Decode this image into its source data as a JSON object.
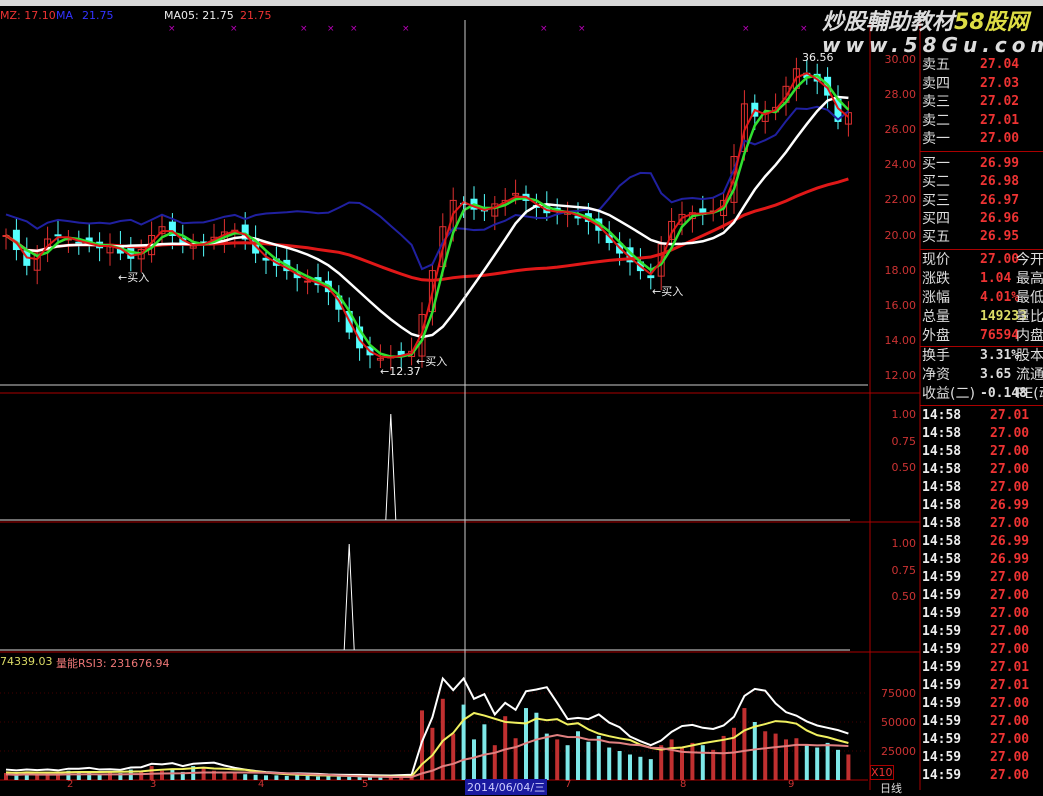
{
  "header": {
    "mz_label": "MZ: 17.10",
    "blue_label": "MA",
    "blue_value": "21.75",
    "ma05_label": "MA05: 21.75",
    "ma05_value": "21.75"
  },
  "watermark": {
    "line1": "炒股輔助教材",
    "line1_brand": "58股网",
    "line2": "www.58Gu.com"
  },
  "annotations": {
    "buy": "←买入",
    "low": "←12.37",
    "high": "36.56"
  },
  "volume_header": {
    "v1": "74339.03",
    "label": "量能RSI3: 231676.94"
  },
  "price_axis": [
    "30.00",
    "28.00",
    "26.00",
    "24.00",
    "22.00",
    "20.00",
    "18.00",
    "16.00",
    "14.00",
    "12.00"
  ],
  "ind_axis": [
    "1.00",
    "0.75",
    "0.50"
  ],
  "vol_axis": [
    "75000",
    "50000",
    "25000"
  ],
  "x_axis": [
    "2",
    "3",
    "4",
    "5",
    "7",
    "8",
    "9"
  ],
  "crosshair_date": "2014/06/04/三",
  "scale_label": "X10",
  "period_label": "日线",
  "orderbook": {
    "sell": [
      {
        "k": "卖五",
        "v": "27.04"
      },
      {
        "k": "卖四",
        "v": "27.03"
      },
      {
        "k": "卖三",
        "v": "27.02"
      },
      {
        "k": "卖二",
        "v": "27.01"
      },
      {
        "k": "卖一",
        "v": "27.00"
      }
    ],
    "buy": [
      {
        "k": "买一",
        "v": "26.99"
      },
      {
        "k": "买二",
        "v": "26.98"
      },
      {
        "k": "买三",
        "v": "26.97"
      },
      {
        "k": "买四",
        "v": "26.96"
      },
      {
        "k": "买五",
        "v": "26.95"
      }
    ]
  },
  "quote": [
    {
      "k": "现价",
      "v": "27.00",
      "x": "今开",
      "c": "#e33"
    },
    {
      "k": "涨跌",
      "v": "1.04",
      "x": "最高",
      "c": "#e33"
    },
    {
      "k": "涨幅",
      "v": "4.01%",
      "x": "最低",
      "c": "#e33"
    },
    {
      "k": "总量",
      "v": "149233",
      "x": "量比",
      "c": "#dd6"
    },
    {
      "k": "外盘",
      "v": "76594",
      "x": "内盘",
      "c": "#e33"
    }
  ],
  "finance": [
    {
      "k": "换手",
      "v": "3.31%",
      "x": "股本"
    },
    {
      "k": "净资",
      "v": "3.65",
      "x": "流通"
    },
    {
      "k": "收益(二)",
      "v": "-0.148",
      "x": "PE(动"
    }
  ],
  "ticks": [
    {
      "t": "14:58",
      "p": "27.01"
    },
    {
      "t": "14:58",
      "p": "27.00"
    },
    {
      "t": "14:58",
      "p": "27.00"
    },
    {
      "t": "14:58",
      "p": "27.00"
    },
    {
      "t": "14:58",
      "p": "27.00"
    },
    {
      "t": "14:58",
      "p": "26.99"
    },
    {
      "t": "14:58",
      "p": "27.00"
    },
    {
      "t": "14:58",
      "p": "26.99"
    },
    {
      "t": "14:58",
      "p": "26.99"
    },
    {
      "t": "14:59",
      "p": "27.00"
    },
    {
      "t": "14:59",
      "p": "27.00"
    },
    {
      "t": "14:59",
      "p": "27.00"
    },
    {
      "t": "14:59",
      "p": "27.00"
    },
    {
      "t": "14:59",
      "p": "27.00"
    },
    {
      "t": "14:59",
      "p": "27.01"
    },
    {
      "t": "14:59",
      "p": "27.01"
    },
    {
      "t": "14:59",
      "p": "27.00"
    },
    {
      "t": "14:59",
      "p": "27.00"
    },
    {
      "t": "14:59",
      "p": "27.00"
    },
    {
      "t": "14:59",
      "p": "27.00"
    },
    {
      "t": "14:59",
      "p": "27.00"
    }
  ],
  "colors": {
    "up": "#e03030",
    "down": "#54ffff",
    "ma_white": "#ffffff",
    "ma_red": "#e01818",
    "band": "#2020a0",
    "green": "#30e030",
    "yellow": "#f0f060"
  },
  "chart_data": {
    "type": "candlestick",
    "closes": [
      20.0,
      19.2,
      18.3,
      19.0,
      19.8,
      20.0,
      19.8,
      19.6,
      19.5,
      19.3,
      19.5,
      19.0,
      18.7,
      19.2,
      20.0,
      20.5,
      20.0,
      19.5,
      19.4,
      19.6,
      19.9,
      20.2,
      20.3,
      19.8,
      19.0,
      18.6,
      18.3,
      18.0,
      17.6,
      17.4,
      17.2,
      16.8,
      15.8,
      14.5,
      13.6,
      13.2,
      13.0,
      13.1,
      13.2,
      13.4,
      15.5,
      18.0,
      20.5,
      22.0,
      21.8,
      21.5,
      21.4,
      21.8,
      22.0,
      22.4,
      22.0,
      21.6,
      21.3,
      21.4,
      21.3,
      21.0,
      20.8,
      20.3,
      19.6,
      19.0,
      18.5,
      18.0,
      17.6,
      19.5,
      20.8,
      21.2,
      21.3,
      21.2,
      21.4,
      22.0,
      24.5,
      27.5,
      26.8,
      27.0,
      27.3,
      28.5,
      29.5,
      29.0,
      28.8,
      28.0,
      26.5,
      27.0
    ],
    "volumes": [
      6000,
      5000,
      7000,
      5000,
      6000,
      5500,
      8000,
      6000,
      7000,
      5000,
      6500,
      6000,
      9000,
      7000,
      12000,
      8000,
      9000,
      7000,
      12000,
      10000,
      8000,
      7000,
      6000,
      5000,
      4500,
      4000,
      4000,
      3500,
      4000,
      3500,
      3000,
      3000,
      3000,
      2800,
      3000,
      2500,
      2500,
      2800,
      3000,
      3200,
      60000,
      45000,
      70000,
      40000,
      65000,
      35000,
      48000,
      30000,
      55000,
      36000,
      62000,
      58000,
      40000,
      35000,
      30000,
      42000,
      33000,
      38000,
      28000,
      25000,
      22000,
      20000,
      18000,
      30000,
      35000,
      28000,
      32000,
      30000,
      26000,
      38000,
      45000,
      62000,
      50000,
      42000,
      40000,
      35000,
      36000,
      30000,
      28000,
      32000,
      26000,
      22000
    ],
    "ind1_spike_index": 37,
    "ind2_spike_index": 33,
    "price_range": [
      11,
      31
    ],
    "volume_range": [
      0,
      110000
    ],
    "ind_range": [
      0,
      1.1
    ]
  }
}
